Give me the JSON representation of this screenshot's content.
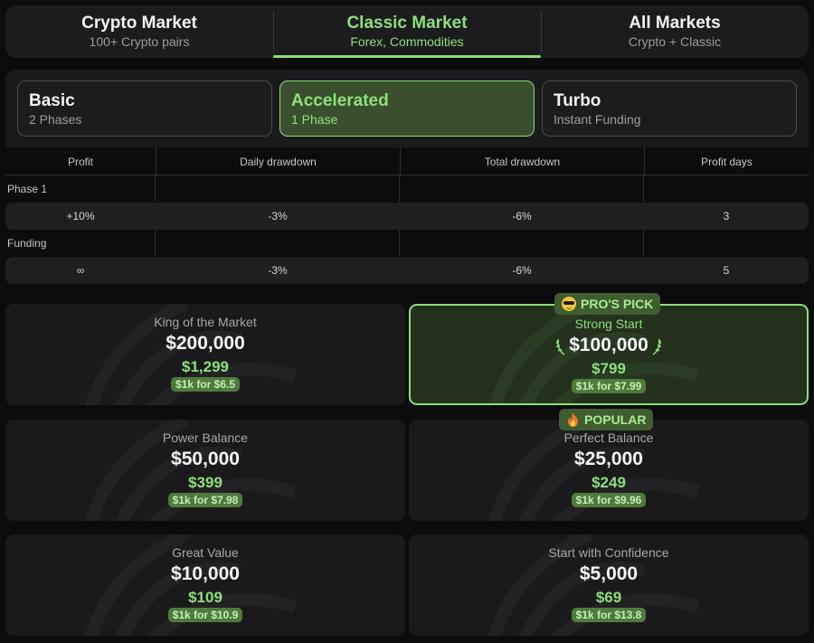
{
  "market_tabs": [
    {
      "title": "Crypto Market",
      "subtitle": "100+ Crypto pairs",
      "active": false
    },
    {
      "title": "Classic Market",
      "subtitle": "Forex, Commodities",
      "active": true
    },
    {
      "title": "All Markets",
      "subtitle": "Crypto + Classic",
      "active": false
    }
  ],
  "challenge_types": [
    {
      "title": "Basic",
      "subtitle": "2 Phases",
      "active": false
    },
    {
      "title": "Accelerated",
      "subtitle": "1 Phase",
      "active": true
    },
    {
      "title": "Turbo",
      "subtitle": "Instant Funding",
      "active": false
    }
  ],
  "rules_table": {
    "headers": [
      "Profit",
      "Daily drawdown",
      "Total drawdown",
      "Profit days"
    ],
    "sections": [
      {
        "label": "Phase 1",
        "values": [
          "+10%",
          "-3%",
          "-6%",
          "3"
        ]
      },
      {
        "label": "Funding",
        "values": [
          "∞",
          "-3%",
          "-6%",
          "5"
        ]
      }
    ]
  },
  "badges": {
    "pros_pick": "PRO'S PICK",
    "popular": "POPULAR"
  },
  "plans": [
    {
      "name": "King of the Market",
      "size": "$200,000",
      "price": "$1,299",
      "rate": "$1k for $6.5"
    },
    {
      "name": "Strong Start",
      "size": "$100,000",
      "price": "$799",
      "rate": "$1k for $7.99",
      "featured": true
    },
    {
      "name": "Power Balance",
      "size": "$50,000",
      "price": "$399",
      "rate": "$1k for $7.98"
    },
    {
      "name": "Perfect Balance",
      "size": "$25,000",
      "price": "$249",
      "rate": "$1k for $9.96"
    },
    {
      "name": "Great Value",
      "size": "$10,000",
      "price": "$109",
      "rate": "$1k for $10.9"
    },
    {
      "name": "Start with Confidence",
      "size": "$5,000",
      "price": "$69",
      "rate": "$1k for $13.8"
    }
  ],
  "colors": {
    "accent": "#8ee07b",
    "background": "#0c0c0d",
    "card": "#1a1a1c"
  }
}
